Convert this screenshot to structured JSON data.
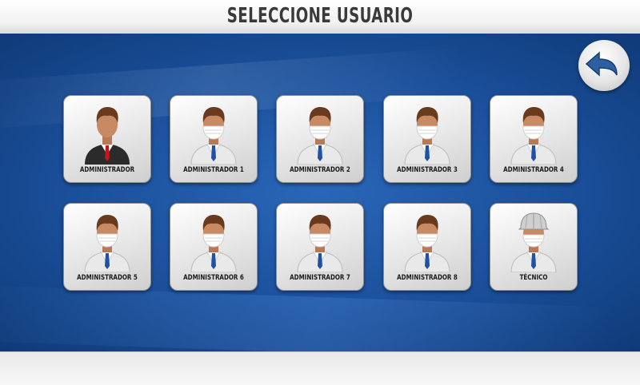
{
  "header": {
    "title": "SELECCIONE USUARIO"
  },
  "back_button": {
    "icon": "back-arrow-icon"
  },
  "users": [
    {
      "label": "ADMINISTRADOR",
      "avatar": "businessman-icon"
    },
    {
      "label": "ADMINISTRADOR 1",
      "avatar": "masked-operator-icon"
    },
    {
      "label": "ADMINISTRADOR 2",
      "avatar": "masked-operator-icon"
    },
    {
      "label": "ADMINISTRADOR 3",
      "avatar": "masked-operator-icon"
    },
    {
      "label": "ADMINISTRADOR 4",
      "avatar": "masked-operator-icon"
    },
    {
      "label": "ADMINISTRADOR 5",
      "avatar": "masked-operator-icon"
    },
    {
      "label": "ADMINISTRADOR 6",
      "avatar": "masked-operator-icon"
    },
    {
      "label": "ADMINISTRADOR 7",
      "avatar": "masked-operator-icon"
    },
    {
      "label": "ADMINISTRADOR 8",
      "avatar": "masked-operator-icon"
    },
    {
      "label": "TÉCNICO",
      "avatar": "technician-helmet-icon"
    }
  ],
  "colors": {
    "background_blue": "#1a4f9a",
    "tie_red": "#c0161d",
    "tie_blue": "#1f52a3",
    "suit_dark": "#2b2b2b"
  }
}
